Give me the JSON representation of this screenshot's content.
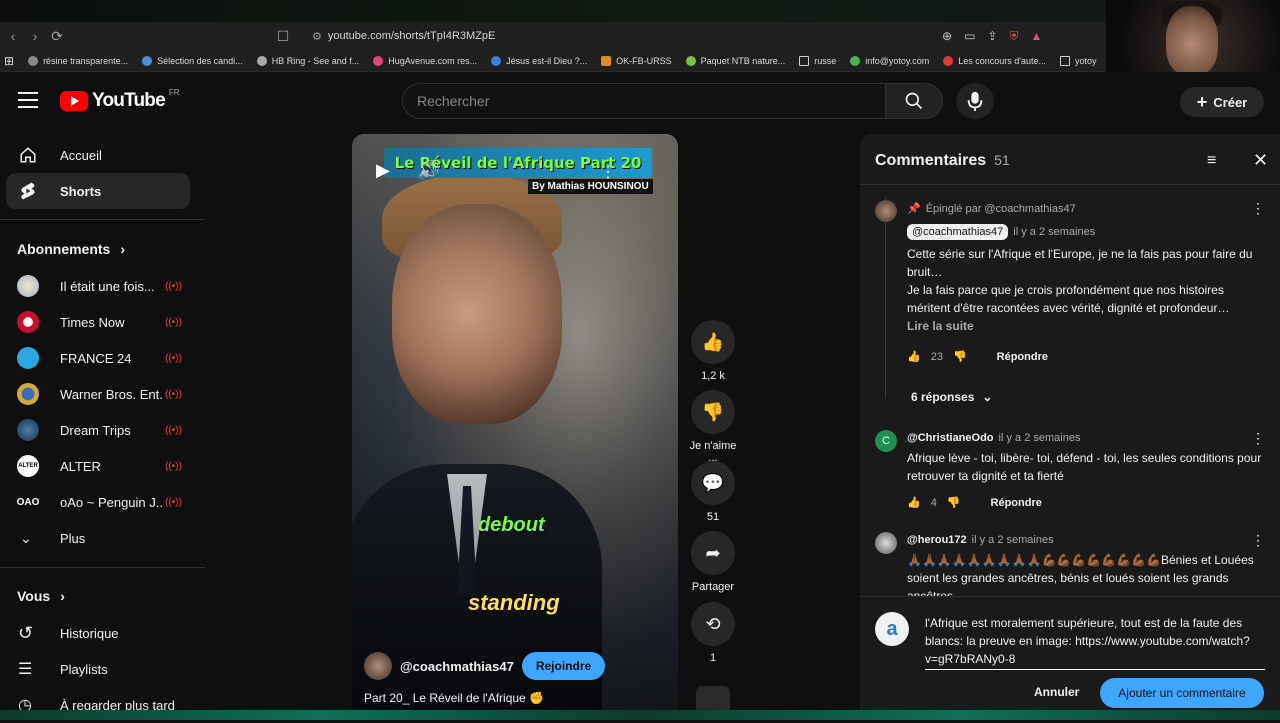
{
  "browser": {
    "url": "youtube.com/shorts/tTpI4R3MZpE",
    "bookmarks": [
      "résine transparente...",
      "Sélection des candi...",
      "HB Ring - See and f...",
      "HugAvenue.com res...",
      "Jésus est-il Dieu ?...",
      "OK-FB-URSS",
      "Paquet NTB nature...",
      "russe",
      "info@yotoy.com",
      "Les concours d'aute...",
      "yotoy"
    ]
  },
  "header": {
    "logo": "YouTube",
    "region": "FR",
    "search_placeholder": "Rechercher",
    "create_label": "Créer"
  },
  "sidebar": {
    "main": [
      {
        "label": "Accueil",
        "icon": "home-icon"
      },
      {
        "label": "Shorts",
        "icon": "shorts-icon",
        "active": true
      }
    ],
    "subscriptions_title": "Abonnements",
    "subscriptions": [
      {
        "name": "Il était une fois...",
        "color": "#c9d7e6"
      },
      {
        "name": "Times Now",
        "color": "#c8102e"
      },
      {
        "name": "FRANCE 24",
        "color": "#2aa9e0"
      },
      {
        "name": "Warner Bros. Ent...",
        "color": "#d4a934"
      },
      {
        "name": "Dream Trips",
        "color": "#1a3350"
      },
      {
        "name": "ALTER",
        "color": "#ffffff"
      },
      {
        "name": "oAo ~ Penguin J...",
        "color": "#0f0f0f"
      }
    ],
    "more_label": "Plus",
    "you_title": "Vous",
    "you_items": [
      {
        "label": "Historique",
        "icon": "history-icon"
      },
      {
        "label": "Playlists",
        "icon": "playlist-icon"
      },
      {
        "label": "À regarder plus tard",
        "icon": "watch-later-icon"
      }
    ],
    "alter_logo": "ALTER",
    "oao_logo": "OAO"
  },
  "video": {
    "title_banner": "Le Réveil de l'Afrique Part 20",
    "byline": "By Mathias HOUNSINOU",
    "caption_1": "debout",
    "caption_2": "standing",
    "channel": "@coachmathias47",
    "join_label": "Rejoindre",
    "description": "Part 20_ Le Réveil de l'Afrique ✊"
  },
  "actions": {
    "likes": "1,2 k",
    "dislike_label": "Je n'aime ...",
    "comments": "51",
    "share_label": "Partager",
    "remix": "1"
  },
  "comments": {
    "title": "Commentaires",
    "count": "51",
    "pinned_label": "Épinglé par @coachmathias47",
    "items": [
      {
        "author": "@coachmathias47",
        "time": "il y a 2 semaines",
        "lines": [
          "Cette série sur l'Afrique et l'Europe, je ne la fais pas pour faire du bruit…",
          "Je la fais parce que je crois profondément que nos histoires méritent d'être racontées avec vérité, dignité et profondeur…"
        ],
        "read_more": "Lire la suite",
        "likes": "23",
        "reply": "Répondre",
        "replies_label": "6 réponses"
      },
      {
        "author": "@ChristianeOdo",
        "time": "il y a 2 semaines",
        "initial": "C",
        "text": "Afrique lève - toi, libère- toi, défend - toi, les seules conditions pour retrouver ta dignité et ta fierté",
        "likes": "4",
        "reply": "Répondre"
      },
      {
        "author": "@herou172",
        "time": "il y a 2 semaines",
        "text": "🙏🏾🙏🏾🙏🏾🙏🏾🙏🏾🙏🏾🙏🏾🙏🏾🙏🏾💪🏾💪🏾💪🏾💪🏾💪🏾💪🏾💪🏾💪🏾Bénies et Louées soient les grandes ancêtres, bénis et loués soient les grands ancêtres"
      }
    ],
    "compose": {
      "avatar_letter": "a",
      "text": "l'Afrique est moralement supérieure, tout est de la faute des blancs: la preuve en image: https://www.youtube.com/watch?v=gR7bRANy0-8",
      "cancel": "Annuler",
      "submit": "Ajouter un commentaire"
    }
  }
}
